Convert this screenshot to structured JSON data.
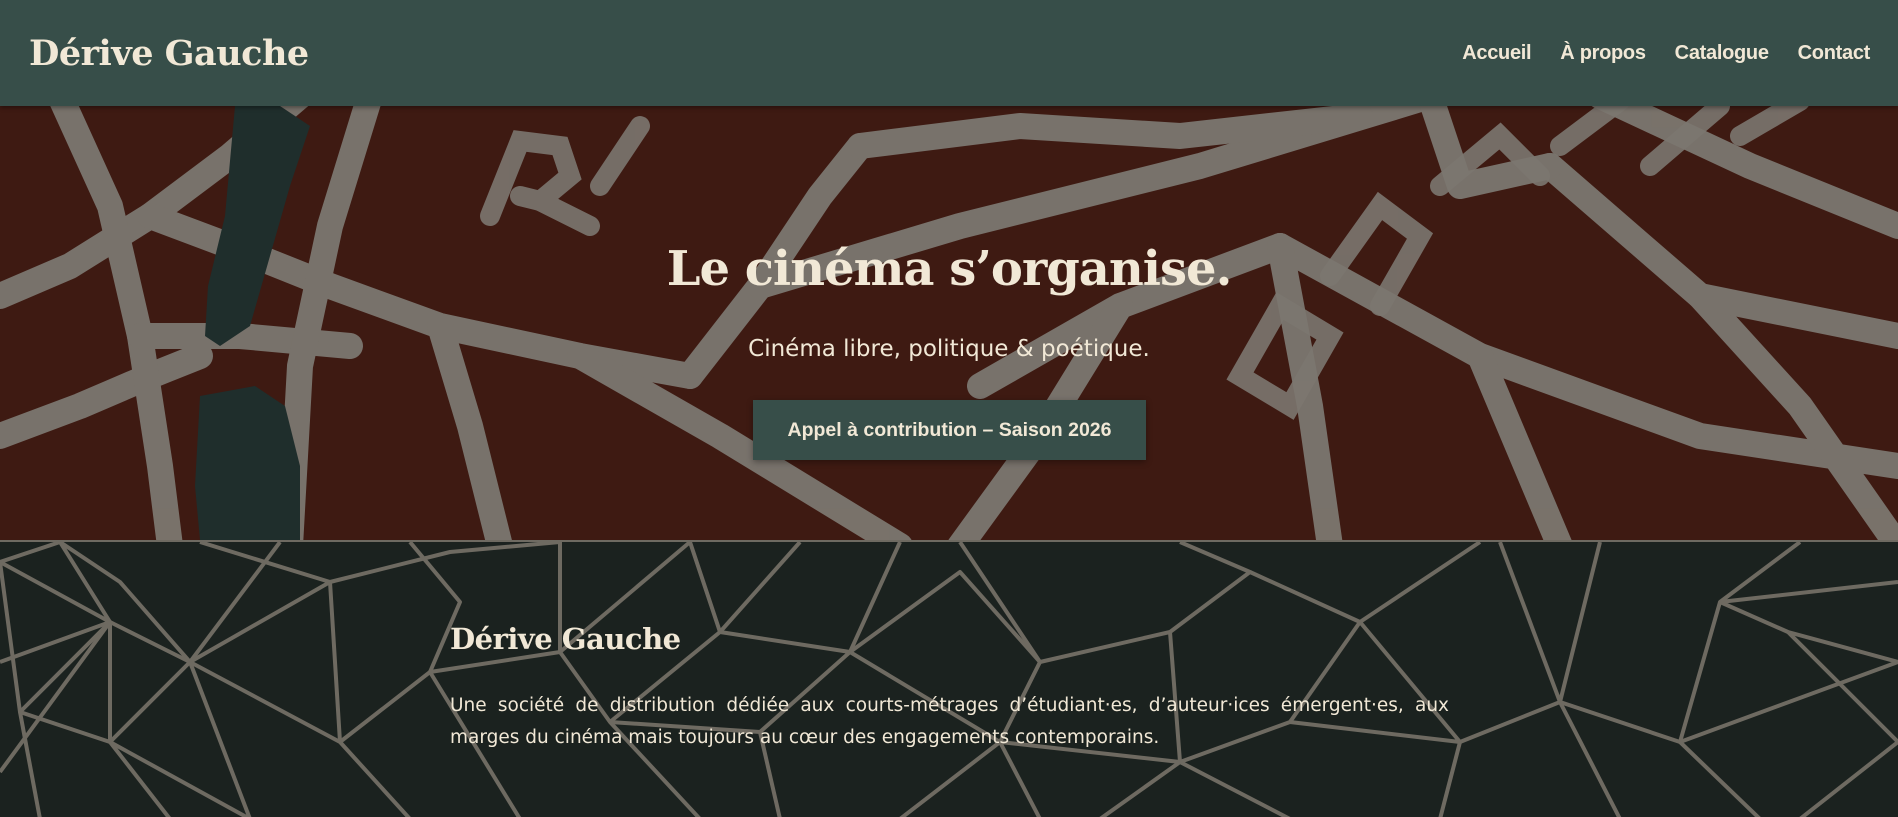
{
  "header": {
    "brand": "Dérive Gauche",
    "nav": [
      "Accueil",
      "À propos",
      "Catalogue",
      "Contact"
    ]
  },
  "hero": {
    "title": "Le cinéma s’organise.",
    "subtitle": "Cinéma libre, politique & poétique.",
    "cta_label": "Appel à contribution – Saison 2026"
  },
  "about": {
    "title": "Dérive Gauche",
    "text": "Une société de distribution dédiée aux courts-métrages d’étudiant·es, d’auteur·ices émergent·es, aux marges du cinéma mais toujours au cœur des engagements contemporains."
  },
  "colors": {
    "nav_bg": "#374e49",
    "hero_bg": "#3e1a12",
    "accent_text": "#f1e8d6",
    "about_bg": "#1b221f",
    "line_color": "#6e6a61"
  }
}
